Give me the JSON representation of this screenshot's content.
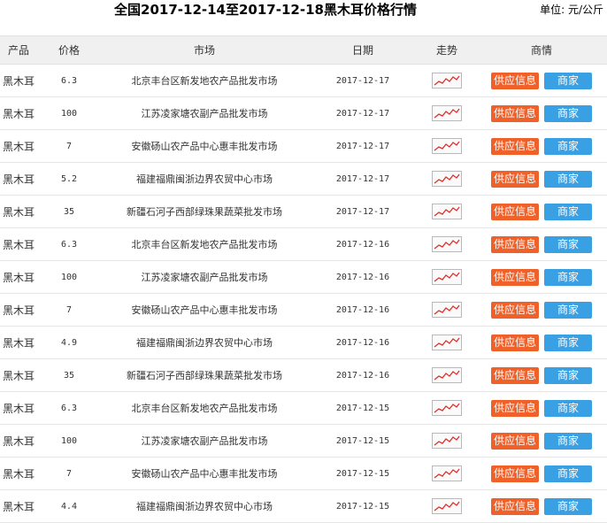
{
  "header": {
    "title": "全国2017-12-14至2017-12-18黑木耳价格行情",
    "unit": "单位: 元/公斤"
  },
  "table": {
    "columns": [
      "产品",
      "价格",
      "市场",
      "日期",
      "走势",
      "商情"
    ],
    "supply_label": "供应信息",
    "merchant_label": "商家",
    "rows": [
      {
        "product": "黑木耳",
        "price": "6.3",
        "market": "北京丰台区新发地农产品批发市场",
        "date": "2017-12-17"
      },
      {
        "product": "黑木耳",
        "price": "100",
        "market": "江苏凌家塘农副产品批发市场",
        "date": "2017-12-17"
      },
      {
        "product": "黑木耳",
        "price": "7",
        "market": "安徽砀山农产品中心惠丰批发市场",
        "date": "2017-12-17"
      },
      {
        "product": "黑木耳",
        "price": "5.2",
        "market": "福建福鼎闽浙边界农贸中心市场",
        "date": "2017-12-17"
      },
      {
        "product": "黑木耳",
        "price": "35",
        "market": "新疆石河子西部绿珠果蔬菜批发市场",
        "date": "2017-12-17"
      },
      {
        "product": "黑木耳",
        "price": "6.3",
        "market": "北京丰台区新发地农产品批发市场",
        "date": "2017-12-16"
      },
      {
        "product": "黑木耳",
        "price": "100",
        "market": "江苏凌家塘农副产品批发市场",
        "date": "2017-12-16"
      },
      {
        "product": "黑木耳",
        "price": "7",
        "market": "安徽砀山农产品中心惠丰批发市场",
        "date": "2017-12-16"
      },
      {
        "product": "黑木耳",
        "price": "4.9",
        "market": "福建福鼎闽浙边界农贸中心市场",
        "date": "2017-12-16"
      },
      {
        "product": "黑木耳",
        "price": "35",
        "market": "新疆石河子西部绿珠果蔬菜批发市场",
        "date": "2017-12-16"
      },
      {
        "product": "黑木耳",
        "price": "6.3",
        "market": "北京丰台区新发地农产品批发市场",
        "date": "2017-12-15"
      },
      {
        "product": "黑木耳",
        "price": "100",
        "market": "江苏凌家塘农副产品批发市场",
        "date": "2017-12-15"
      },
      {
        "product": "黑木耳",
        "price": "7",
        "market": "安徽砀山农产品中心惠丰批发市场",
        "date": "2017-12-15"
      },
      {
        "product": "黑木耳",
        "price": "4.4",
        "market": "福建福鼎闽浙边界农贸中心市场",
        "date": "2017-12-15"
      }
    ]
  },
  "icons": {
    "trend": "trend-chart-icon"
  },
  "colors": {
    "supply_button": "#f0612a",
    "merchant_button": "#3aa0e4",
    "trend_line": "#e0302a",
    "header_bg": "#f0f0f0"
  }
}
